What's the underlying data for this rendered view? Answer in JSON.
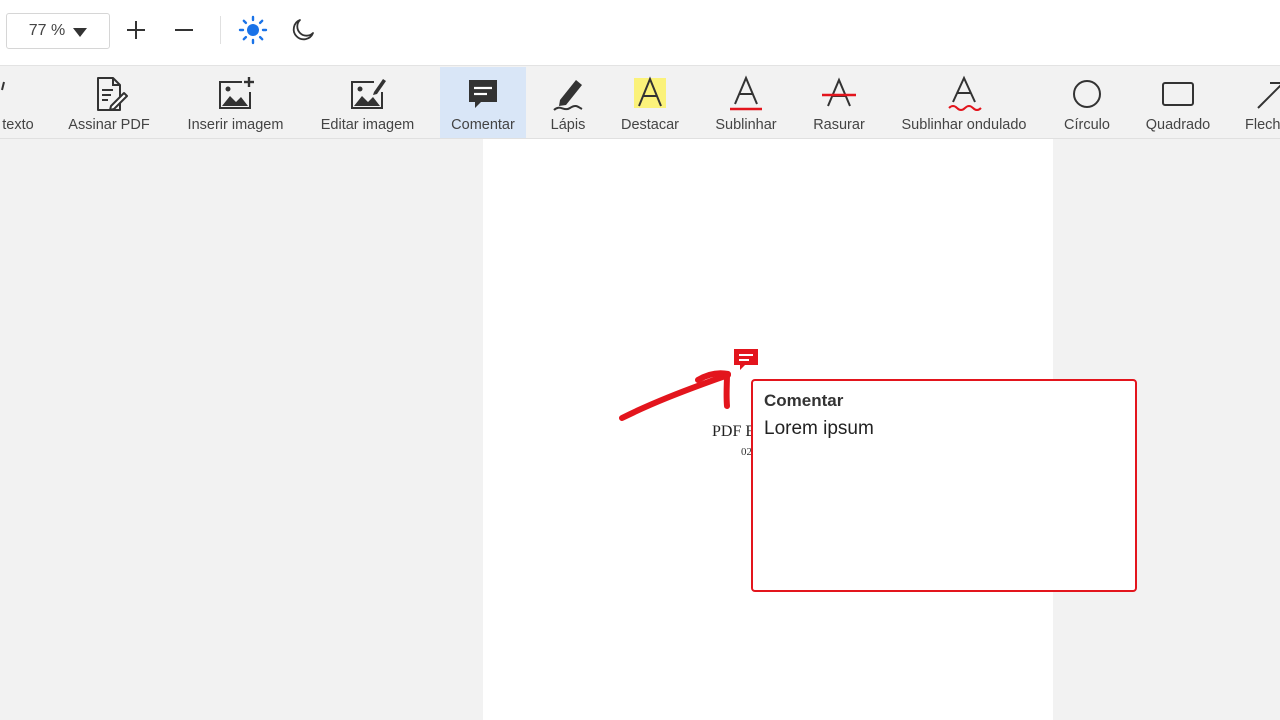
{
  "topbar": {
    "zoom_value": "77 %",
    "icons": [
      "plus-icon",
      "minus-icon",
      "sun-icon",
      "moon-icon"
    ]
  },
  "toolbar": {
    "tools": [
      {
        "label": "texto",
        "icon": "text-icon"
      },
      {
        "label": "Assinar PDF",
        "icon": "sign-document-icon"
      },
      {
        "label": "Inserir imagem",
        "icon": "image-add-icon"
      },
      {
        "label": "Editar imagem",
        "icon": "image-edit-icon"
      },
      {
        "label": "Comentar",
        "icon": "comment-icon",
        "active": true
      },
      {
        "label": "Lápis",
        "icon": "pencil-icon"
      },
      {
        "label": "Destacar",
        "icon": "highlight-icon"
      },
      {
        "label": "Sublinhar",
        "icon": "underline-icon"
      },
      {
        "label": "Rasurar",
        "icon": "strikethrough-icon"
      },
      {
        "label": "Sublinhar ondulado",
        "icon": "wavy-underline-icon"
      },
      {
        "label": "Círculo",
        "icon": "circle-icon"
      },
      {
        "label": "Quadrado",
        "icon": "square-icon"
      },
      {
        "label": "Flech",
        "icon": "arrow-icon"
      }
    ]
  },
  "document": {
    "title_fragment": "PDF E",
    "subtitle_fragment": "02"
  },
  "comment": {
    "title": "Comentar",
    "body": "Lorem ipsum"
  },
  "colors": {
    "accent_active": "#d9e6f7",
    "annotation_red": "#e3151d",
    "highlight_yellow": "#fbf27a",
    "sun_blue": "#1a73e8"
  }
}
